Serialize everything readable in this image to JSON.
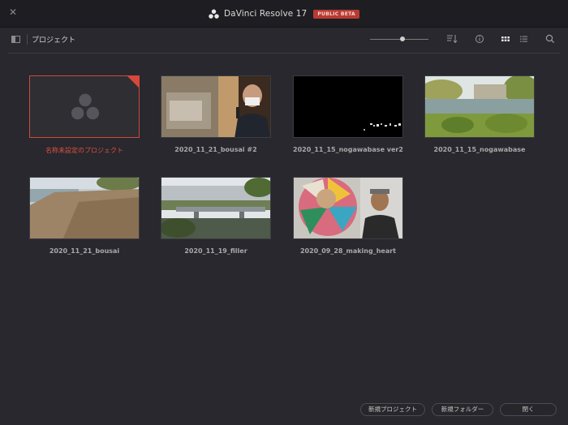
{
  "window": {
    "title": "DaVinci Resolve 17",
    "badge": "PUBLIC BETA"
  },
  "toolbar": {
    "breadcrumb": "プロジェクト",
    "zoom_level": 0.55
  },
  "projects": [
    {
      "name": "名称未設定のプロジェクト",
      "selected": true,
      "thumb": "placeholder"
    },
    {
      "name": "2020_11_21_bousai #2",
      "selected": false,
      "thumb": "interview"
    },
    {
      "name": "2020_11_15_nogawabase ver2",
      "selected": false,
      "thumb": "black"
    },
    {
      "name": "2020_11_15_nogawabase",
      "selected": false,
      "thumb": "riverside"
    },
    {
      "name": "2020_11_21_bousai",
      "selected": false,
      "thumb": "riverbank"
    },
    {
      "name": "2020_11_19_filler",
      "selected": false,
      "thumb": "bridge"
    },
    {
      "name": "2020_09_28_making_heart",
      "selected": false,
      "thumb": "mural"
    }
  ],
  "footer": {
    "new_project": "新規プロジェクト",
    "new_folder": "新規フォルダー",
    "close": "閉く"
  },
  "colors": {
    "accent": "#d14a3c",
    "background": "#28282e",
    "titlebar": "#1e1e22"
  }
}
